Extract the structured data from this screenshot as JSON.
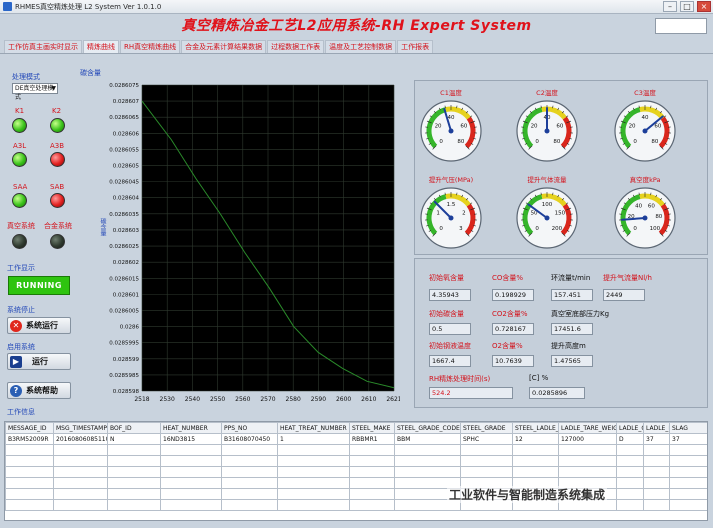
{
  "window": {
    "title": "RHMES真空精炼处理 L2 System Ver  1.0.1.0  "
  },
  "app_title": "真空精炼冶金工艺L2应用系统-RH Expert System",
  "tabs": [
    "工作仿真主画实时显示",
    "精炼曲线",
    "RH真空精炼曲线",
    "合金及元素计算结果数据",
    "过程数据工作表",
    "温度及工艺控制数据",
    "工作报表"
  ],
  "left": {
    "mode_label": "处理模式",
    "mode_value": "DE真空处理模式",
    "leds": [
      {
        "label": "K1",
        "color": "green"
      },
      {
        "label": "K2",
        "color": "green"
      },
      {
        "label": "A3L",
        "color": "green"
      },
      {
        "label": "A3B",
        "color": "red"
      },
      {
        "label": "SAA",
        "color": "green"
      },
      {
        "label": "SAB",
        "color": "red"
      },
      {
        "label": "真空系统",
        "color": "dark"
      },
      {
        "label": "合金系统",
        "color": "dark"
      }
    ],
    "work_display_label": "工作显示",
    "running_text": "RUNNING",
    "stop_label": "系统停止",
    "system_run_button": "系统运行",
    "enable_label": "启用系统",
    "run_button": "运行",
    "help_button": "系统帮助",
    "work_message_label": "工作信息"
  },
  "chart_data": {
    "type": "line",
    "title": "碳含量",
    "ylabel": "碳含量",
    "xlabel": "",
    "x_ticks": [
      "2518",
      "2530",
      "2540",
      "2550",
      "2560",
      "2570",
      "2580",
      "2590",
      "2600",
      "2610",
      "2621"
    ],
    "y_ticks": [
      "0.0286075",
      "0.028607",
      "0.0286065",
      "0.028606",
      "0.0286055",
      "0.028605",
      "0.0286045",
      "0.028604",
      "0.0286035",
      "0.028603",
      "0.0286025",
      "0.028602",
      "0.0286015",
      "0.028601",
      "0.0286005",
      "0.0286",
      "0.0285995",
      "0.028599",
      "0.0285985",
      "0.028598"
    ],
    "xlim": [
      2518,
      2621
    ],
    "ylim": [
      0.028598,
      0.0286075
    ],
    "grid": true,
    "series": [
      {
        "x": [
          2518,
          2530,
          2540,
          2550,
          2560,
          2570,
          2580,
          2590,
          2600,
          2610,
          2621
        ],
        "y": [
          0.028607,
          0.0286058,
          0.0286046,
          0.0286035,
          0.0286023,
          0.0286012,
          0.0286,
          0.0285992,
          0.0285987,
          0.0285983,
          0.0285981
        ],
        "color": "#2a8a2a"
      }
    ]
  },
  "gauges": [
    {
      "title": "C1温度",
      "min": 0,
      "max": 80,
      "value": 35,
      "ticks": [
        "0",
        "20",
        "40",
        "60",
        "80"
      ]
    },
    {
      "title": "C2温度",
      "min": 0,
      "max": 80,
      "value": 40,
      "ticks": [
        "0",
        "20",
        "40",
        "60",
        "80"
      ]
    },
    {
      "title": "C3温度",
      "min": 0,
      "max": 80,
      "value": 55,
      "ticks": [
        "0",
        "20",
        "40",
        "60",
        "80"
      ]
    },
    {
      "title": "提升气压(MPa)",
      "min": 0,
      "max": 3,
      "value": 1.0,
      "ticks": [
        "0",
        "1",
        "1.5",
        "2",
        "3"
      ]
    },
    {
      "title": "提升气体流量",
      "min": 0,
      "max": 200,
      "value": 60,
      "ticks": [
        "0",
        "50",
        "100",
        "150",
        "200"
      ]
    },
    {
      "title": "真空度kPa",
      "min": 0,
      "max": 100,
      "value": 15,
      "ticks": [
        "0",
        "20",
        "40",
        "60",
        "80",
        "100"
      ]
    }
  ],
  "data_fields": [
    {
      "label": "初始氧含量",
      "value": "4.35943"
    },
    {
      "label": "CO含量%",
      "value": "0.198929"
    },
    {
      "label": "环流量t/min",
      "value": "157.451"
    },
    {
      "label": "提升气流量Nl/h",
      "value": "2449"
    },
    {
      "label": "初始碳含量",
      "value": "0.5"
    },
    {
      "label": "CO2含量%",
      "value": "0.728167"
    },
    {
      "label": "真空室底部压力Kg",
      "value": "17451.6"
    },
    {
      "label": "初始钢液温度",
      "value": "1667.4"
    },
    {
      "label": "O2含量%",
      "value": "10.7639"
    },
    {
      "label": "提升高度m",
      "value": "1.47565"
    }
  ],
  "rh_time": {
    "label": "RH精炼处理时间(s)",
    "value": "524.2"
  },
  "c_result": {
    "label": "[C] %",
    "value": "0.0285896"
  },
  "table": {
    "columns": [
      "MESSAGE_ID",
      "MSG_TIMESTAMP",
      "BOF_ID",
      "HEAT_NUMBER",
      "PPS_NO",
      "HEAT_TREAT_NUMBER",
      "STEEL_MAKE",
      "STEEL_GRADE_CODE",
      "STEEL_GRADE",
      "STEEL_LADLE_NO",
      "LADLE_TARE_WEIGHT",
      "LADLE_Q",
      "LADLE_LIFE",
      "SLAG"
    ],
    "rows": [
      [
        "B3RM52009R",
        "20160806085110",
        "N",
        "16ND3815",
        "B31608070450",
        "1",
        "RBBMR1",
        "BBM",
        "SPHC",
        "12",
        "127000",
        "D",
        "37",
        "37"
      ]
    ]
  },
  "watermark": "工业软件与智能制造系统集成"
}
